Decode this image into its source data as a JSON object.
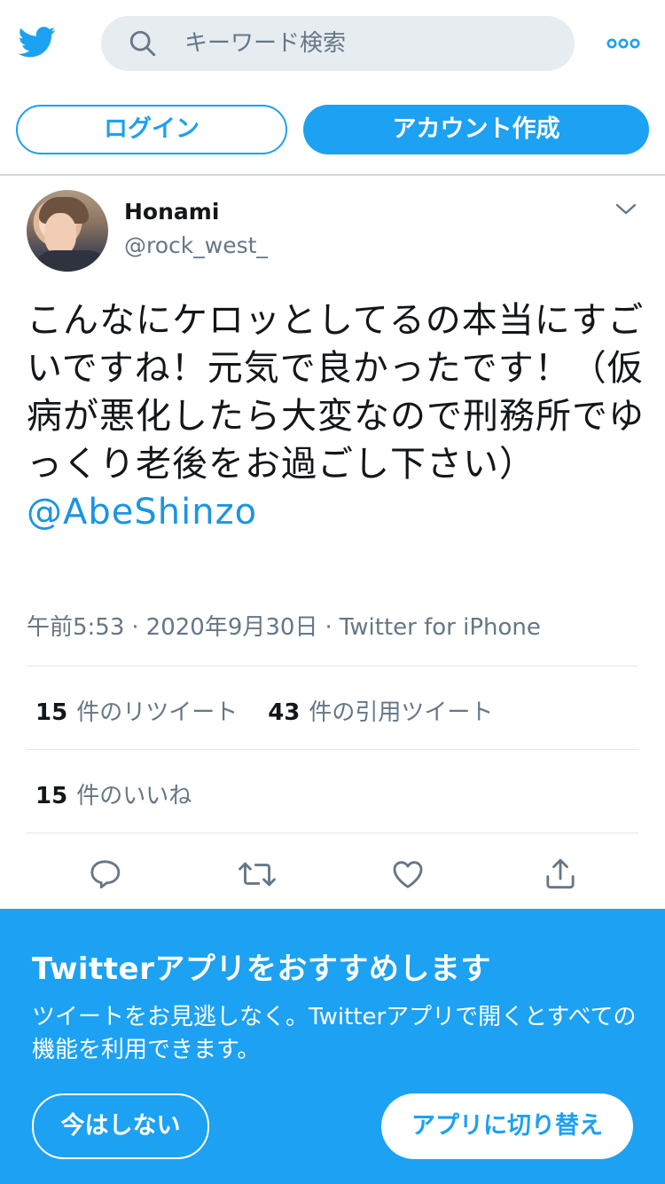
{
  "header": {
    "search_placeholder": "キーワード検索",
    "login_label": "ログイン",
    "signup_label": "アカウント作成"
  },
  "tweet": {
    "author_name": "Honami",
    "author_handle": "@rock_west_",
    "text": "こんなにケロッとしてるの本当にすごいですね！元気で良かったです！（仮病が悪化したら大変なので刑務所でゆっくり老後をお過ごし下さい）",
    "mention": "@AbeShinzo",
    "time": "午前5:53",
    "date": "2020年9月30日",
    "source": "Twitter for iPhone",
    "retweets_count": "15",
    "retweets_label": "件のリツイート",
    "quotes_count": "43",
    "quotes_label": "件の引用ツイート",
    "likes_count": "15",
    "likes_label": "件のいいね"
  },
  "banner": {
    "title": "Twitterアプリをおすすめします",
    "description": "ツイートをお見逃しなく。Twitterアプリで開くとすべての機能を利用できます。",
    "not_now_label": "今はしない",
    "switch_label": "アプリに切り替え"
  },
  "icons": {
    "logo": "twitter-bird-icon",
    "search": "search-icon",
    "more": "more-icon",
    "caret": "chevron-down-icon",
    "reply": "reply-icon",
    "retweet": "retweet-icon",
    "like": "heart-icon",
    "share": "share-icon"
  },
  "colors": {
    "brand": "#1da1f2",
    "link": "#1b95e0",
    "secondary_text": "#657786"
  }
}
